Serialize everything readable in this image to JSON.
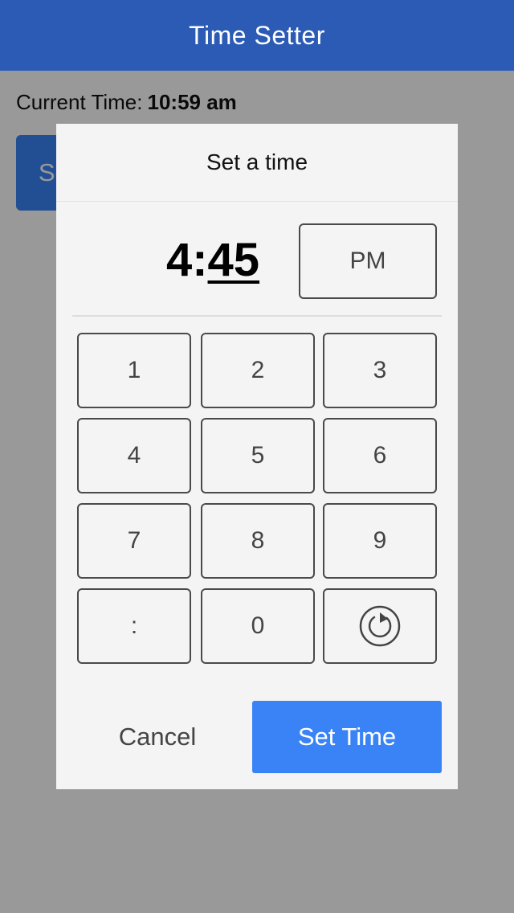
{
  "app": {
    "title": "Time Setter"
  },
  "main": {
    "current_time_label": "Current Time:",
    "current_time_value": "10:59 am",
    "set_time_button": "Set Time"
  },
  "colors": {
    "header_bg": "#2b5bb5",
    "accent": "#3a83f7",
    "overlay": "rgba(0,0,0,0.4)",
    "modal_bg": "#f4f4f4"
  },
  "dialog": {
    "title": "Set a time",
    "time_hours": "4",
    "time_separator": ":",
    "time_minutes": "45",
    "meridiem": "PM",
    "keys": [
      "1",
      "2",
      "3",
      "4",
      "5",
      "6",
      "7",
      "8",
      "9",
      ":",
      "0"
    ],
    "reset_icon": "reset-icon",
    "cancel_button": "Cancel",
    "confirm_button": "Set Time"
  }
}
